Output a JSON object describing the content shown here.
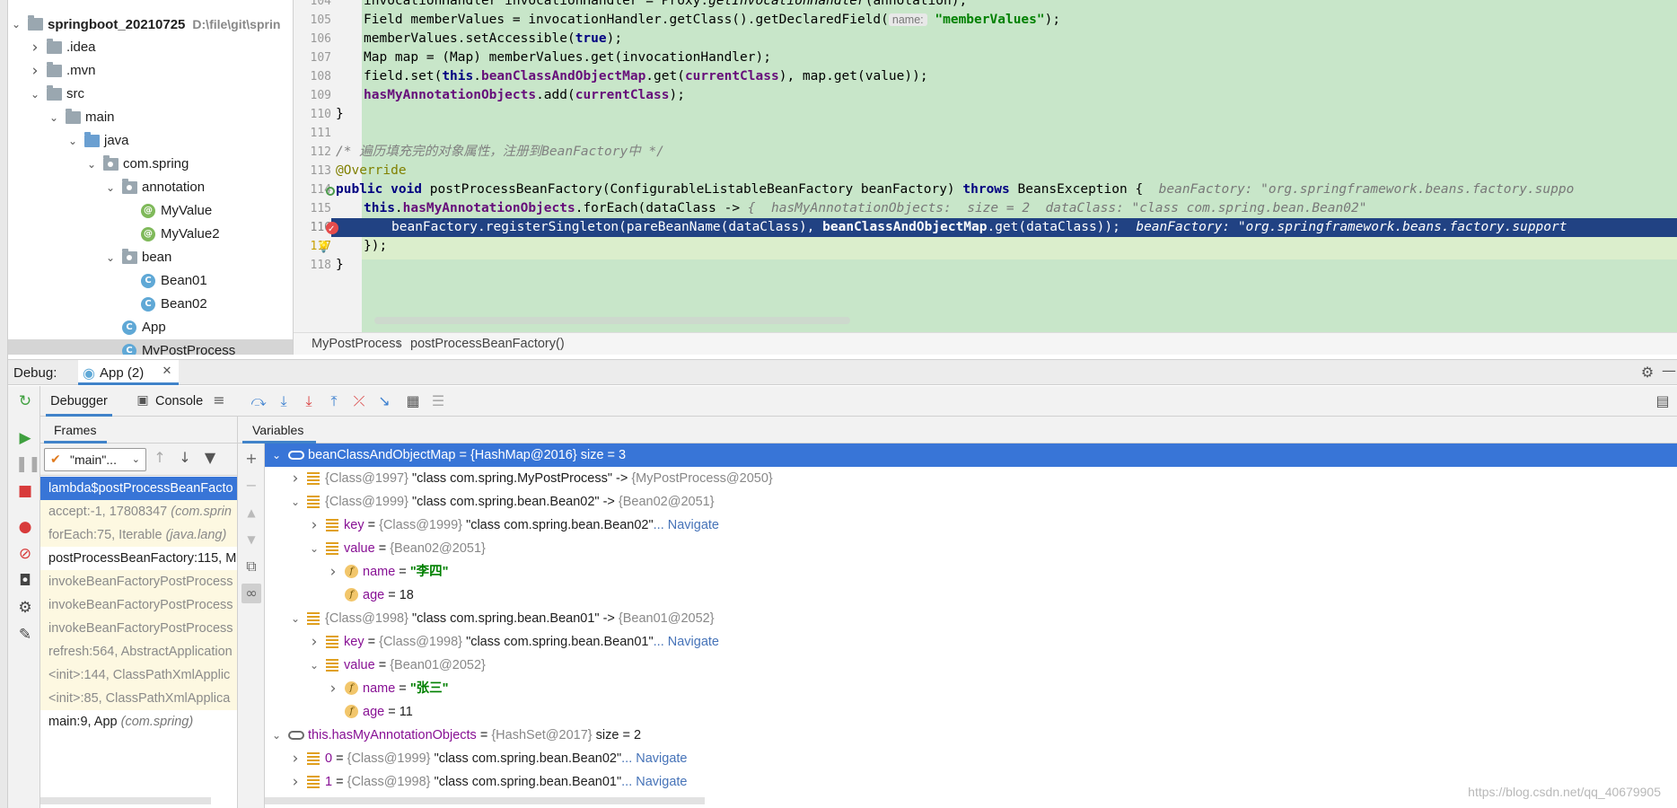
{
  "project": {
    "root_name": "springboot_20210725",
    "root_path": "D:\\file\\git\\sprin",
    "tree": [
      {
        "label": ".idea",
        "level": 1,
        "arrow": "right",
        "icon": "folder"
      },
      {
        "label": ".mvn",
        "level": 1,
        "arrow": "right",
        "icon": "folder"
      },
      {
        "label": "src",
        "level": 1,
        "arrow": "down",
        "icon": "folder"
      },
      {
        "label": "main",
        "level": 2,
        "arrow": "down",
        "icon": "folder"
      },
      {
        "label": "java",
        "level": 3,
        "arrow": "down",
        "icon": "source-folder"
      },
      {
        "label": "com.spring",
        "level": 4,
        "arrow": "down",
        "icon": "package"
      },
      {
        "label": "annotation",
        "level": 5,
        "arrow": "down",
        "icon": "package"
      },
      {
        "label": "MyValue",
        "level": 6,
        "arrow": "none",
        "icon": "annotation"
      },
      {
        "label": "MyValue2",
        "level": 6,
        "arrow": "none",
        "icon": "annotation"
      },
      {
        "label": "bean",
        "level": 5,
        "arrow": "down",
        "icon": "package"
      },
      {
        "label": "Bean01",
        "level": 6,
        "arrow": "none",
        "icon": "class"
      },
      {
        "label": "Bean02",
        "level": 6,
        "arrow": "none",
        "icon": "class"
      },
      {
        "label": "App",
        "level": 5,
        "arrow": "none",
        "icon": "class"
      },
      {
        "label": "MyPostProcess",
        "level": 5,
        "arrow": "none",
        "icon": "class",
        "selected": true
      }
    ]
  },
  "editor": {
    "lines": [
      {
        "num": "104",
        "parts": [
          [
            "",
            "invocationHandler invocationHandler = Proxy."
          ],
          [
            "ital",
            "getInvocationHandler"
          ],
          [
            "",
            "(annotation);"
          ]
        ],
        "indent": 1
      },
      {
        "num": "105",
        "parts": [
          [
            "",
            "Field memberValues = invocationHandler.getClass().getDeclaredField("
          ],
          [
            "hint",
            "name:"
          ],
          [
            "",
            " "
          ],
          [
            "str",
            "\"memberValues\""
          ],
          [
            "",
            ");"
          ]
        ],
        "indent": 1
      },
      {
        "num": "106",
        "parts": [
          [
            "",
            "memberValues.setAccessible("
          ],
          [
            "kw",
            "true"
          ],
          [
            "",
            ");"
          ]
        ],
        "indent": 1
      },
      {
        "num": "107",
        "parts": [
          [
            "",
            "Map map = (Map) memberValues.get(invocationHandler);"
          ]
        ],
        "indent": 1
      },
      {
        "num": "108",
        "parts": [
          [
            "",
            "field.set("
          ],
          [
            "kw",
            "this"
          ],
          [
            "",
            "."
          ],
          [
            "fld",
            "beanClassAndObjectMap"
          ],
          [
            "",
            ".get("
          ],
          [
            "fld",
            "currentClass"
          ],
          [
            "",
            "), map.get(value));"
          ]
        ],
        "indent": 1
      },
      {
        "num": "109",
        "parts": [
          [
            "fld",
            "hasMyAnnotationObjects"
          ],
          [
            "",
            ".add("
          ],
          [
            "fld",
            "currentClass"
          ],
          [
            "",
            ");"
          ]
        ],
        "indent": 1
      },
      {
        "num": "110",
        "parts": [
          [
            "",
            "}"
          ]
        ],
        "indent": 0
      },
      {
        "num": "111",
        "parts": [],
        "indent": 0
      },
      {
        "num": "112",
        "parts": [
          [
            "cmt",
            "/* 遍历填充完的对象属性，注册到BeanFactory中 */"
          ]
        ],
        "indent": 0
      },
      {
        "num": "113",
        "parts": [
          [
            "anno",
            "@Override"
          ]
        ],
        "indent": 0
      },
      {
        "num": "114",
        "parts": [
          [
            "kw",
            "public void "
          ],
          [
            "",
            "postProcessBeanFactory(ConfigurableListableBeanFactory beanFactory) "
          ],
          [
            "kw",
            "throws "
          ],
          [
            "",
            "BeansException {  "
          ],
          [
            "iv",
            "beanFactory: \"org.springframework.beans.factory.suppo"
          ]
        ],
        "indent": 0
      },
      {
        "num": "115",
        "parts": [
          [
            "kw",
            "this"
          ],
          [
            "",
            "."
          ],
          [
            "fld",
            "hasMyAnnotationObjects"
          ],
          [
            "",
            ".forEach(dataClass -> "
          ],
          [
            "iv",
            "{  hasMyAnnotationObjects:  size = 2  dataClass: \"class com.spring.bean.Bean02\""
          ]
        ],
        "indent": 1
      },
      {
        "num": "116",
        "parts": [
          [
            "",
            "beanFactory.registerSingleton(pareBeanName(dataClass), "
          ],
          [
            "fld",
            "beanClassAndObjectMap"
          ],
          [
            "",
            ".get(dataClass));  "
          ],
          [
            "iv",
            "beanFactory: \"org.springframework.beans.factory.support"
          ]
        ],
        "indent": 2
      },
      {
        "num": "117",
        "parts": [
          [
            "",
            "});"
          ]
        ],
        "indent": 1
      },
      {
        "num": "118",
        "parts": [
          [
            "",
            "}"
          ]
        ],
        "indent": 0
      }
    ]
  },
  "breadcrumb": {
    "class": "MyPostProcess",
    "sep": "›",
    "method": "postProcessBeanFactory()"
  },
  "debug": {
    "label": "Debug:",
    "run_tab": "App (2)",
    "tabs": {
      "debugger": "Debugger",
      "console": "Console"
    },
    "frames_label": "Frames",
    "variables_label": "Variables",
    "thread": "\"main\"...",
    "frames": [
      {
        "name": "lambda$postProcessBeanFacto",
        "pkg": "",
        "kind": "sel"
      },
      {
        "name": "accept:-1, 17808347 ",
        "pkg": "(com.sprin",
        "kind": "lib"
      },
      {
        "name": "forEach:75, Iterable ",
        "pkg": "(java.lang)",
        "kind": "lib"
      },
      {
        "name": "postProcessBeanFactory:115, M",
        "pkg": "",
        "kind": "normal"
      },
      {
        "name": "invokeBeanFactoryPostProcess",
        "pkg": "",
        "kind": "lib"
      },
      {
        "name": "invokeBeanFactoryPostProcess",
        "pkg": "",
        "kind": "lib"
      },
      {
        "name": "invokeBeanFactoryPostProcess",
        "pkg": "",
        "kind": "lib"
      },
      {
        "name": "refresh:564, AbstractApplication",
        "pkg": "",
        "kind": "lib"
      },
      {
        "name": "<init>:144, ClassPathXmlApplic",
        "pkg": "",
        "kind": "lib"
      },
      {
        "name": "<init>:85, ClassPathXmlApplica",
        "pkg": "",
        "kind": "lib"
      },
      {
        "name": "main:9, App ",
        "pkg": "(com.spring)",
        "kind": "normal"
      }
    ],
    "variables": [
      {
        "level": 0,
        "arrow": "down",
        "icon": "watch",
        "name": "beanClassAndObjectMap",
        "type": "{HashMap@2016}",
        "value": "size = 3",
        "selected": true
      },
      {
        "level": 1,
        "arrow": "right",
        "icon": "entry",
        "name": "",
        "type": "{Class@1997}",
        "value": "\"class com.spring.MyPostProcess\"",
        "suffix": " -> ",
        "type2": "{MyPostProcess@2050}"
      },
      {
        "level": 1,
        "arrow": "down",
        "icon": "entry",
        "name": "",
        "type": "{Class@1999}",
        "value": "\"class com.spring.bean.Bean02\"",
        "suffix": " -> ",
        "type2": "{Bean02@2051}"
      },
      {
        "level": 2,
        "arrow": "right",
        "icon": "entry",
        "name": "key",
        "type": "{Class@1999}",
        "value": "\"class com.spring.bean.Bean02\"",
        "nav": "... Navigate"
      },
      {
        "level": 2,
        "arrow": "down",
        "icon": "entry",
        "name": "value",
        "type": "{Bean02@2051}",
        "value": ""
      },
      {
        "level": 3,
        "arrow": "right",
        "icon": "field",
        "name": "name",
        "type": "",
        "value": "\"李四\"",
        "str": true
      },
      {
        "level": 3,
        "arrow": "none",
        "icon": "field",
        "name": "age",
        "type": "",
        "value": "18"
      },
      {
        "level": 1,
        "arrow": "down",
        "icon": "entry",
        "name": "",
        "type": "{Class@1998}",
        "value": "\"class com.spring.bean.Bean01\"",
        "suffix": " -> ",
        "type2": "{Bean01@2052}"
      },
      {
        "level": 2,
        "arrow": "right",
        "icon": "entry",
        "name": "key",
        "type": "{Class@1998}",
        "value": "\"class com.spring.bean.Bean01\"",
        "nav": "... Navigate"
      },
      {
        "level": 2,
        "arrow": "down",
        "icon": "entry",
        "name": "value",
        "type": "{Bean01@2052}",
        "value": ""
      },
      {
        "level": 3,
        "arrow": "right",
        "icon": "field",
        "name": "name",
        "type": "",
        "value": "\"张三\"",
        "str": true
      },
      {
        "level": 3,
        "arrow": "none",
        "icon": "field",
        "name": "age",
        "type": "",
        "value": "11"
      },
      {
        "level": 0,
        "arrow": "down",
        "icon": "watch",
        "name": "this.hasMyAnnotationObjects",
        "type": "{HashSet@2017}",
        "value": "size = 2"
      },
      {
        "level": 1,
        "arrow": "right",
        "icon": "entry",
        "name": "0",
        "type": "{Class@1999}",
        "value": "\"class com.spring.bean.Bean02\"",
        "nav": "... Navigate"
      },
      {
        "level": 1,
        "arrow": "right",
        "icon": "entry",
        "name": "1",
        "type": "{Class@1998}",
        "value": "\"class com.spring.bean.Bean01\"",
        "nav": "... Navigate"
      }
    ]
  },
  "watermark": "https://blog.csdn.net/qq_40679905",
  "colors": {
    "selection": "#3875d7",
    "current_line": "#214283",
    "editor_bg": "#c8e6c9",
    "accent": "#4083c9"
  }
}
